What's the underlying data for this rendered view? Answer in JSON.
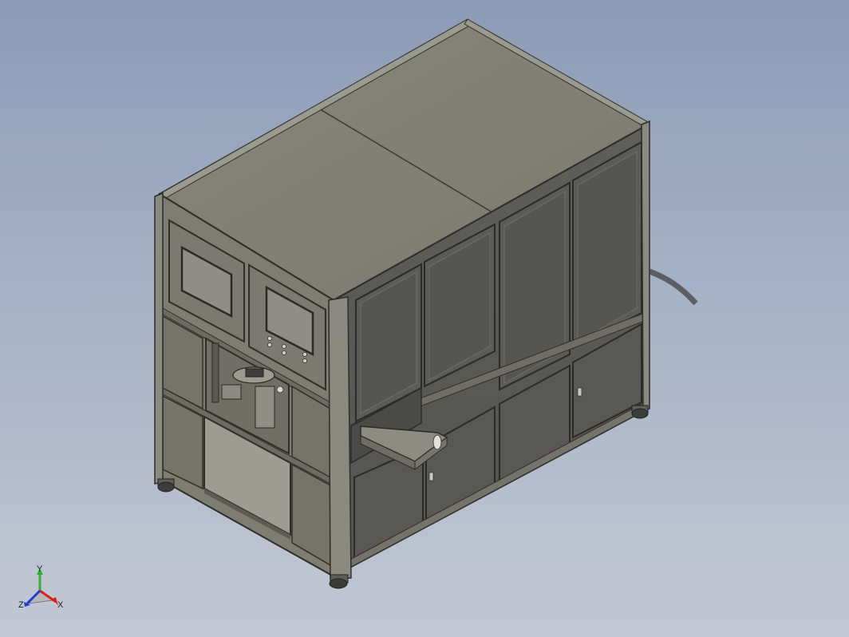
{
  "viewport": {
    "background_top": "#8c9bb6",
    "background_bottom": "#c3c8d3"
  },
  "model": {
    "frame_color": "#6b6d60",
    "top_panel_color": "#7f7f73",
    "front_panel_color": "#7d7d72",
    "side_panel_color": "#5a5a56",
    "lower_panel_color": "#565654",
    "screen_color": "#8e8e86",
    "conveyor_color": "#8a8a80"
  },
  "triad": {
    "x_label": "X",
    "y_label": "Y",
    "z_label": "Z",
    "x_color": "#d8201c",
    "y_color": "#2fb12a",
    "z_color": "#1f3ad6"
  }
}
